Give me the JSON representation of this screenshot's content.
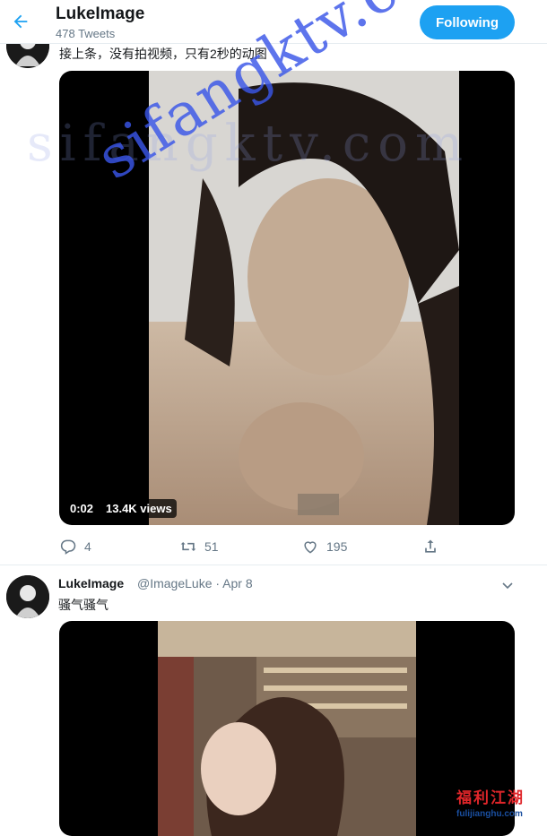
{
  "header": {
    "profile_name": "LukeImage",
    "tweet_count": "478 Tweets",
    "follow_label": "Following"
  },
  "tweet1": {
    "text": "接上条，没有拍视频，只有2秒的动图",
    "duration": "0:02",
    "views": "13.4K views",
    "replies": "4",
    "retweets": "51",
    "likes": "195"
  },
  "tweet2": {
    "name": "LukeImage",
    "handle_date": "@ImageLuke · Apr 8",
    "text": "骚气骚气"
  },
  "watermark": {
    "site": "sifangktv.com",
    "badge_main": "福利江湖",
    "badge_sub": "fulijianghu.com"
  },
  "colors": {
    "accent": "#1da1f2",
    "muted": "#657786",
    "watermark": "#3a56e8"
  },
  "icons": [
    "back-arrow-icon",
    "reply-icon",
    "retweet-icon",
    "like-icon",
    "share-icon",
    "chevron-down-icon"
  ]
}
